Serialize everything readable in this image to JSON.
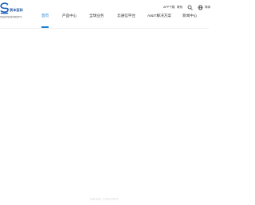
{
  "header": {
    "logo": {
      "name": "贸丰亚科",
      "tagline": "贸易技术驱动的智能平台"
    },
    "nav": [
      {
        "label": "首页",
        "active": true
      },
      {
        "label": "产品中心",
        "active": false
      },
      {
        "label": "全球业务",
        "active": false
      },
      {
        "label": "云通信平台",
        "active": false
      },
      {
        "label": "AI&IT解决方案",
        "active": false
      },
      {
        "label": "新闻中心",
        "active": false
      }
    ],
    "utils": {
      "app_download": "APP下载",
      "contact": "联系",
      "language": "简体"
    },
    "accent_color": "#1b7fd8"
  },
  "main": {
    "section_watermark": "NEWS CENTER"
  }
}
